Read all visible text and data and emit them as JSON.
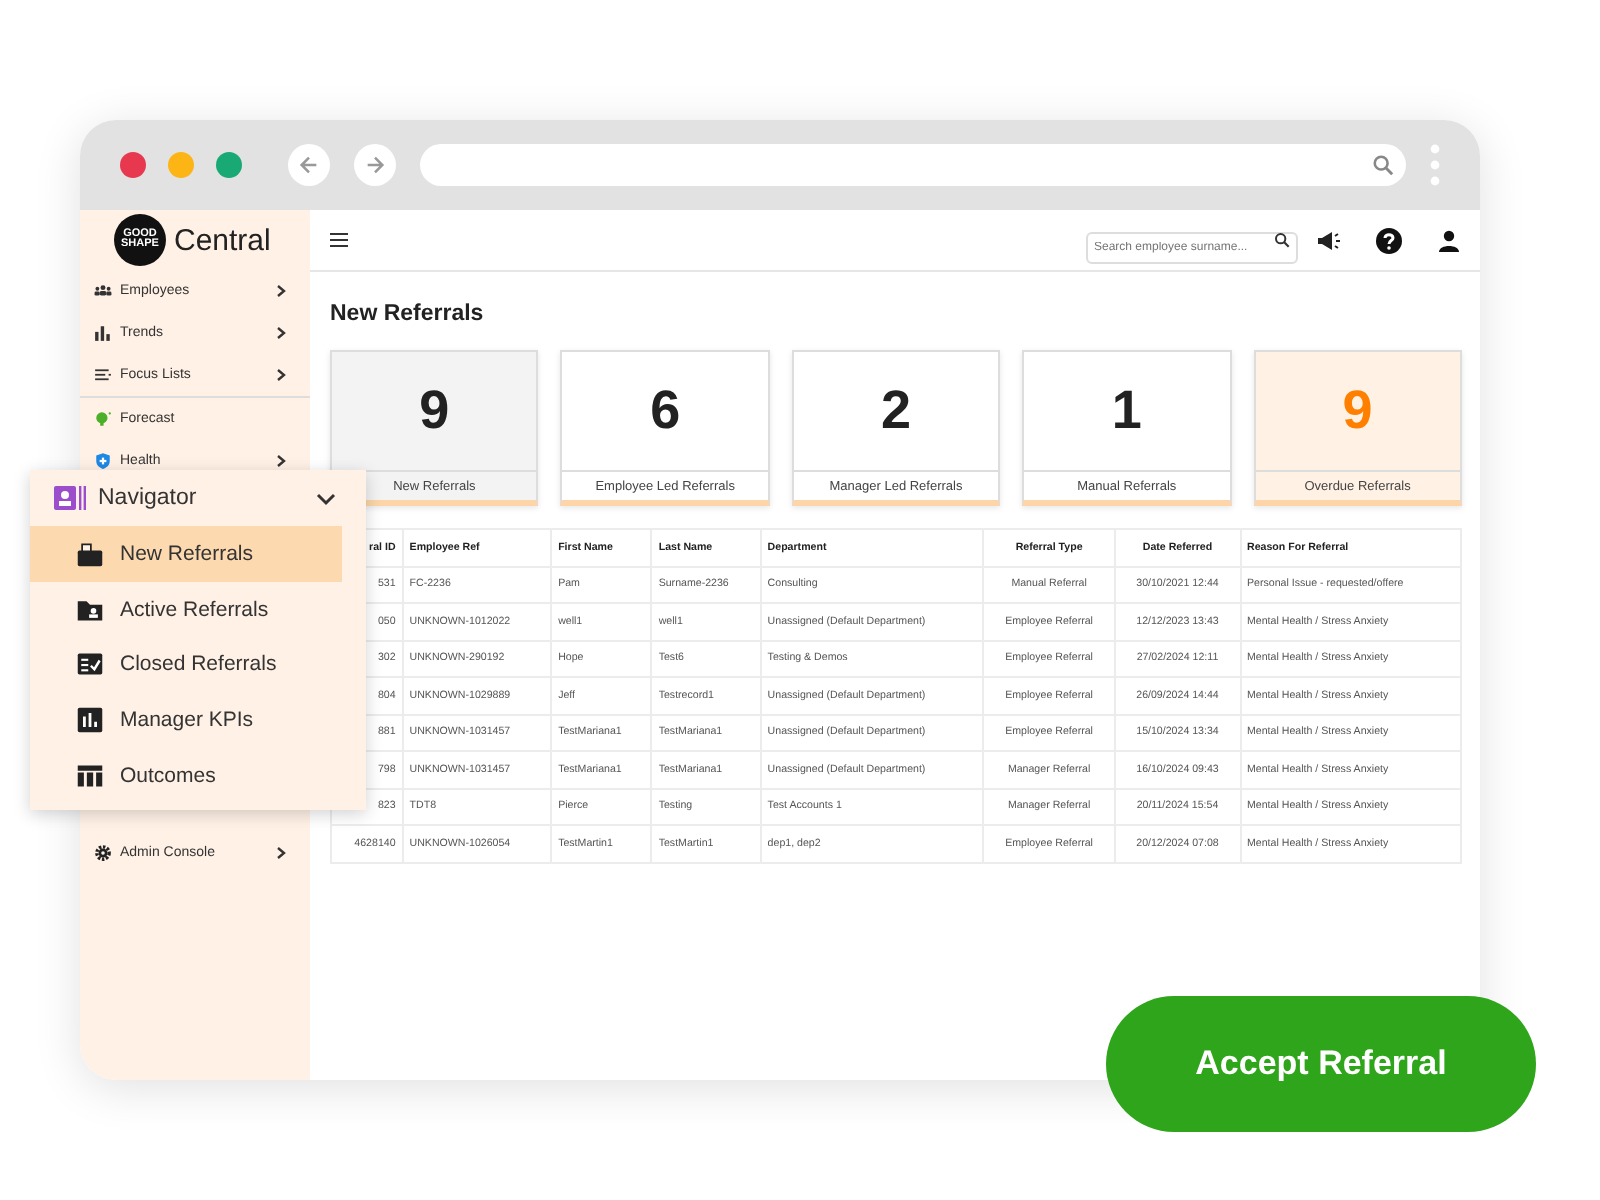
{
  "app": {
    "logo_badge": "GOOD SHAPE",
    "logo_name": "Central",
    "search": {
      "placeholder": "Search employee surname..."
    }
  },
  "sidebar": {
    "items": [
      {
        "label": "Employees",
        "kind": "people",
        "expandable": true,
        "separated": false
      },
      {
        "label": "Trends",
        "kind": "bars",
        "expandable": true,
        "separated": false
      },
      {
        "label": "Focus Lists",
        "kind": "list",
        "expandable": true,
        "separated": false
      },
      {
        "label": "Forecast",
        "kind": "bulb",
        "expandable": false,
        "separated": true
      },
      {
        "label": "Health",
        "kind": "shield",
        "expandable": true,
        "separated": false
      }
    ],
    "lower_items": [
      {
        "label": "Admin Console",
        "kind": "gear",
        "expandable": true,
        "separated": false
      }
    ]
  },
  "page_title": "New Referrals",
  "cards": [
    {
      "count": "9",
      "label": "New Referrals",
      "selected": true,
      "kind": "normal"
    },
    {
      "count": "6",
      "label": "Employee Led Referrals",
      "selected": false,
      "kind": "normal"
    },
    {
      "count": "2",
      "label": "Manager Led Referrals",
      "selected": false,
      "kind": "normal"
    },
    {
      "count": "1",
      "label": "Manual Referrals",
      "selected": false,
      "kind": "normal"
    },
    {
      "count": "9",
      "label": "Overdue Referrals",
      "selected": false,
      "kind": "overdue"
    }
  ],
  "table": {
    "columns": [
      "ral ID",
      "Employee Ref",
      "First Name",
      "Last Name",
      "Department",
      "Referral Type",
      "Date Referred",
      "Reason For Referral"
    ],
    "rows": [
      [
        "531",
        "FC-2236",
        "Pam",
        "Surname-2236",
        "Consulting",
        "Manual Referral",
        "30/10/2021 12:44",
        "Personal Issue - requested/offere"
      ],
      [
        "050",
        "UNKNOWN-1012022",
        "well1",
        "well1",
        "Unassigned (Default Department)",
        "Employee Referral",
        "12/12/2023 13:43",
        "Mental Health / Stress Anxiety"
      ],
      [
        "302",
        "UNKNOWN-290192",
        "Hope",
        "Test6",
        "Testing & Demos",
        "Employee Referral",
        "27/02/2024 12:11",
        "Mental Health / Stress Anxiety"
      ],
      [
        "804",
        "UNKNOWN-1029889",
        "Jeff",
        "Testrecord1",
        "Unassigned (Default Department)",
        "Employee Referral",
        "26/09/2024 14:44",
        "Mental Health / Stress Anxiety"
      ],
      [
        "881",
        "UNKNOWN-1031457",
        "TestMariana1",
        "TestMariana1",
        "Unassigned (Default Department)",
        "Employee Referral",
        "15/10/2024 13:34",
        "Mental Health / Stress Anxiety"
      ],
      [
        "798",
        "UNKNOWN-1031457",
        "TestMariana1",
        "TestMariana1",
        "Unassigned (Default Department)",
        "Manager Referral",
        "16/10/2024 09:43",
        "Mental Health / Stress Anxiety"
      ],
      [
        "823",
        "TDT8",
        "Pierce",
        "Testing",
        "Test Accounts 1",
        "Manager Referral",
        "20/11/2024 15:54",
        "Mental Health / Stress Anxiety"
      ],
      [
        "4628140",
        "UNKNOWN-1026054",
        "TestMartin1",
        "TestMartin1",
        "dep1, dep2",
        "Employee Referral",
        "20/12/2024 07:08",
        "Mental Health / Stress Anxiety"
      ]
    ]
  },
  "navigator": {
    "title": "Navigator",
    "expanded": true,
    "items": [
      {
        "label": "New Referrals",
        "kind": "inbox",
        "selected": true
      },
      {
        "label": "Active Referrals",
        "kind": "folder",
        "selected": false
      },
      {
        "label": "Closed Referrals",
        "kind": "checklist",
        "selected": false
      },
      {
        "label": "Manager KPIs",
        "kind": "chart",
        "selected": false
      },
      {
        "label": "Outcomes",
        "kind": "table",
        "selected": false
      }
    ]
  },
  "action_button": "Accept Referral"
}
